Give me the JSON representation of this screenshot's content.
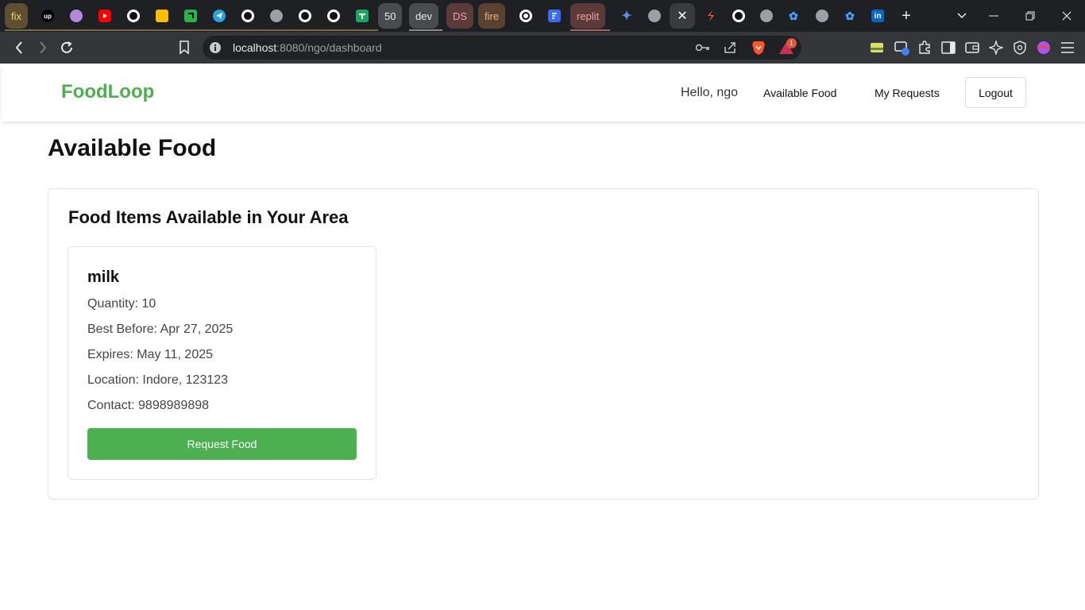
{
  "browser": {
    "tabs": [
      {
        "label": "fix",
        "kind": "group",
        "color": "#5c5030",
        "text_color": "#f0d080"
      },
      {
        "label": "up",
        "kind": "favicon",
        "icon": "upwork-icon"
      },
      {
        "label": "",
        "kind": "favicon",
        "icon": "notion-avatar-icon"
      },
      {
        "label": "",
        "kind": "favicon",
        "icon": "youtube-icon"
      },
      {
        "label": "",
        "kind": "favicon",
        "icon": "github-icon"
      },
      {
        "label": "",
        "kind": "favicon",
        "icon": "keep-icon"
      },
      {
        "label": "",
        "kind": "favicon",
        "icon": "notion-icon"
      },
      {
        "label": "",
        "kind": "favicon",
        "icon": "telegram-icon"
      },
      {
        "label": "",
        "kind": "favicon",
        "icon": "github-icon"
      },
      {
        "label": "",
        "kind": "favicon",
        "icon": "globe-icon"
      },
      {
        "label": "",
        "kind": "favicon",
        "icon": "github-icon"
      },
      {
        "label": "",
        "kind": "favicon",
        "icon": "github-icon"
      },
      {
        "label": "",
        "kind": "favicon",
        "icon": "sheets-icon"
      },
      {
        "label": "50",
        "kind": "group",
        "color": "#4a4b4f",
        "text_color": "#e8e8e8"
      },
      {
        "label": "dev",
        "kind": "group",
        "color": "#4a4b4f",
        "text_color": "#e8e8e8"
      },
      {
        "label": "DS",
        "kind": "group",
        "color": "#5a3a3a",
        "text_color": "#f0a0a0"
      },
      {
        "label": "fire",
        "kind": "group",
        "color": "#5a4232",
        "text_color": "#f0b080"
      },
      {
        "label": "",
        "kind": "favicon",
        "icon": "openai-icon"
      },
      {
        "label": "",
        "kind": "favicon",
        "icon": "forms-icon"
      },
      {
        "label": "replit",
        "kind": "group",
        "color": "#5a3a3a",
        "text_color": "#f0a0a0"
      },
      {
        "label": "",
        "kind": "favicon",
        "icon": "gemini-icon"
      },
      {
        "label": "",
        "kind": "favicon",
        "icon": "globe-icon"
      },
      {
        "label": "",
        "kind": "active-close",
        "icon": "close-icon"
      },
      {
        "label": "",
        "kind": "favicon",
        "icon": "svelte-icon"
      },
      {
        "label": "",
        "kind": "favicon",
        "icon": "github-icon"
      },
      {
        "label": "",
        "kind": "favicon",
        "icon": "globe-icon"
      },
      {
        "label": "",
        "kind": "favicon",
        "icon": "bluesky-icon"
      },
      {
        "label": "",
        "kind": "favicon",
        "icon": "globe-icon"
      },
      {
        "label": "",
        "kind": "favicon",
        "icon": "bluesky-icon"
      },
      {
        "label": "",
        "kind": "favicon",
        "icon": "linkedin-icon"
      }
    ],
    "url_host": "localhost",
    "url_rest": ":8080/ngo/dashboard",
    "notification_count": "1"
  },
  "app": {
    "brand": "FoodLoop",
    "greeting": "Hello, ngo",
    "nav": {
      "available_food": "Available Food",
      "my_requests": "My Requests",
      "logout": "Logout"
    },
    "page_title": "Available Food",
    "panel_title": "Food Items Available in Your Area",
    "accent_color": "#4caf50",
    "items": [
      {
        "name": "milk",
        "quantity": "Quantity: 10",
        "best_before": "Best Before: Apr 27, 2025",
        "expires": "Expires: May 11, 2025",
        "location": "Location: Indore, 123123",
        "contact": "Contact: 9898989898",
        "action": "Request Food"
      }
    ]
  }
}
